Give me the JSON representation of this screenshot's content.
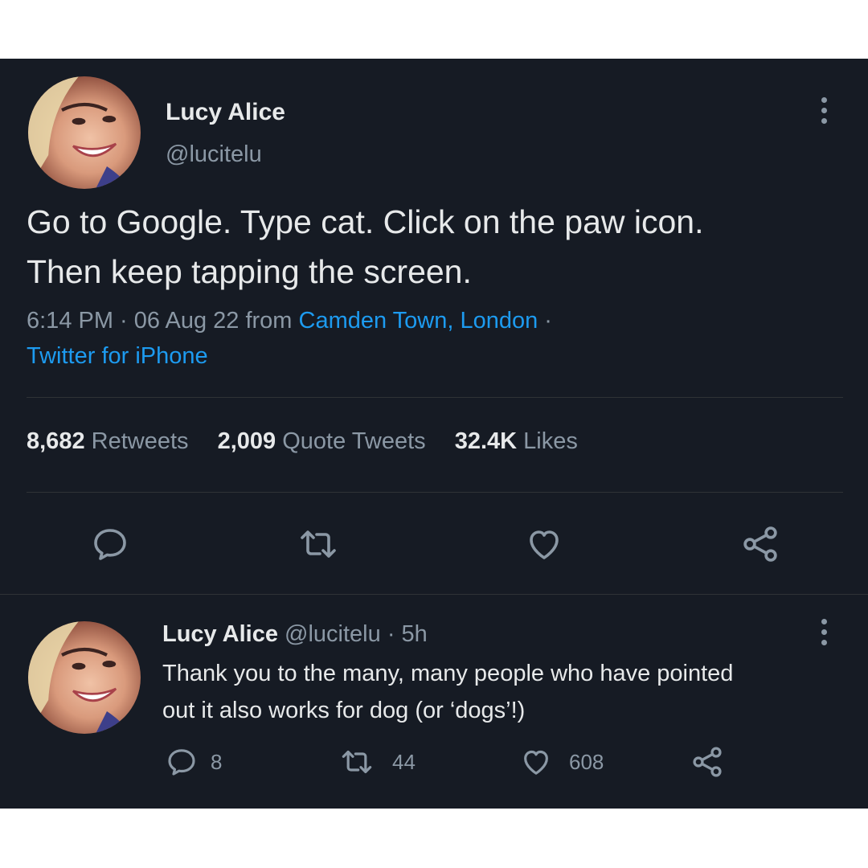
{
  "main_tweet": {
    "display_name": "Lucy Alice",
    "handle": "@lucitelu",
    "text_line1": "Go to Google. Type cat. Click on the paw icon.",
    "text_line2": "Then keep tapping the screen.",
    "time": "6:14 PM · 06 Aug 22 from ",
    "location": "Camden Town, London",
    "separator": " ·",
    "source": "Twitter for iPhone",
    "stats": {
      "retweets_count": "8,682",
      "retweets_label": "Retweets",
      "quotes_count": "2,009",
      "quotes_label": "Quote Tweets",
      "likes_count": "32.4K",
      "likes_label": "Likes"
    }
  },
  "reply": {
    "display_name": "Lucy Alice",
    "handle_time": "@lucitelu · 5h",
    "text_line1": "Thank you to the many, many people who have pointed",
    "text_line2": "out it also works for dog (or ‘dogs’!)",
    "replies": "8",
    "retweets": "44",
    "likes": "608"
  },
  "colors": {
    "background": "#161b24",
    "text": "#e7e9ea",
    "secondary": "#8b98a5",
    "link": "#1d9bf0"
  },
  "icons": [
    "reply-icon",
    "retweet-icon",
    "like-icon",
    "share-icon",
    "more-icon"
  ]
}
